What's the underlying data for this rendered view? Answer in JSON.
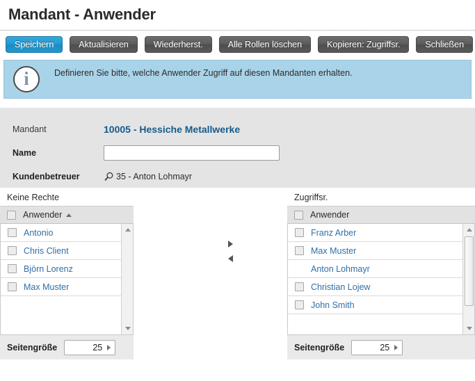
{
  "page": {
    "title": "Mandant - Anwender"
  },
  "toolbar": {
    "buttons": [
      {
        "label": "Speichern",
        "primary": true
      },
      {
        "label": "Aktualisieren",
        "primary": false
      },
      {
        "label": "Wiederherst.",
        "primary": false
      },
      {
        "label": "Alle Rollen löschen",
        "primary": false
      },
      {
        "label": "Kopieren: Zugriffsr.",
        "primary": false
      },
      {
        "label": "Schließen",
        "primary": false
      }
    ]
  },
  "banner": {
    "icon": "info-icon",
    "glyph": "i",
    "text": "Definieren Sie bitte, welche Anwender Zugriff auf diesen Mandanten erhalten.",
    "background_color": "#a9d3e8"
  },
  "form": {
    "mandant_label": "Mandant",
    "mandant_value": "10005 - Hessiche Metallwerke",
    "name_label": "Name",
    "name_value": "",
    "name_placeholder": "",
    "betreuer_label": "Kundenbetreuer",
    "betreuer_value": "35 - Anton Lohmayr",
    "betreuer_icon": "magnifier-icon"
  },
  "lists": {
    "transfer_right_icon": "arrow-right-icon",
    "transfer_left_icon": "arrow-left-icon",
    "left": {
      "caption": "Keine Rechte",
      "column_header": "Anwender",
      "sort": "asc",
      "header_checkbox": true,
      "rows": [
        {
          "name": "Antonio",
          "checkbox": true,
          "checked": false
        },
        {
          "name": "Chris Client",
          "checkbox": true,
          "checked": false
        },
        {
          "name": "Björn Lorenz",
          "checkbox": true,
          "checked": false
        },
        {
          "name": "Max Muster",
          "checkbox": true,
          "checked": false
        }
      ],
      "scroll": {
        "thumb": false
      },
      "footer_label": "Seitengröße",
      "page_size": "25"
    },
    "right": {
      "caption": "Zugriffsr.",
      "column_header": "Anwender",
      "sort": "none",
      "header_checkbox": true,
      "rows": [
        {
          "name": "Franz Arber",
          "checkbox": true,
          "checked": false
        },
        {
          "name": "Max Muster",
          "checkbox": true,
          "checked": false
        },
        {
          "name": "Anton Lohmayr",
          "checkbox": false,
          "checked": false
        },
        {
          "name": "Christian Lojew",
          "checkbox": true,
          "checked": false
        },
        {
          "name": "John Smith",
          "checkbox": true,
          "checked": false
        }
      ],
      "scroll": {
        "thumb": true
      },
      "footer_label": "Seitengröße",
      "page_size": "25"
    }
  },
  "colors": {
    "accent": "#2199cf",
    "link": "#2f6fa8",
    "banner": "#a9d3e8",
    "panel": "#e4e4e4",
    "button": "#5a5a5a"
  }
}
